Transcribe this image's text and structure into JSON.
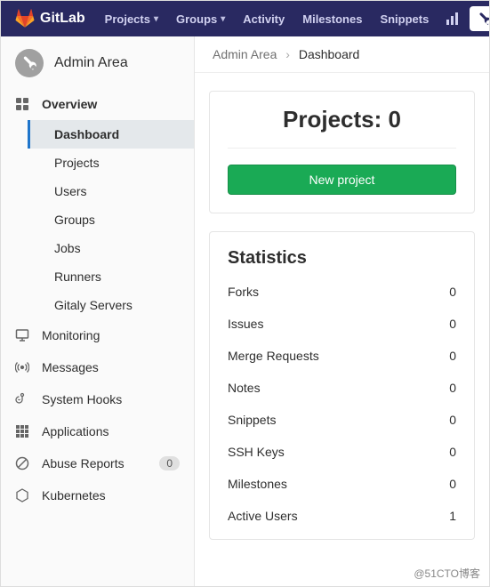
{
  "brand": "GitLab",
  "topnav": {
    "items": [
      {
        "label": "Projects",
        "has_dropdown": true
      },
      {
        "label": "Groups",
        "has_dropdown": true
      },
      {
        "label": "Activity",
        "has_dropdown": false
      },
      {
        "label": "Milestones",
        "has_dropdown": false
      },
      {
        "label": "Snippets",
        "has_dropdown": false
      }
    ]
  },
  "sidebar": {
    "title": "Admin Area",
    "overview_label": "Overview",
    "overview_children": [
      {
        "label": "Dashboard"
      },
      {
        "label": "Projects"
      },
      {
        "label": "Users"
      },
      {
        "label": "Groups"
      },
      {
        "label": "Jobs"
      },
      {
        "label": "Runners"
      },
      {
        "label": "Gitaly Servers"
      }
    ],
    "items": [
      {
        "label": "Monitoring"
      },
      {
        "label": "Messages"
      },
      {
        "label": "System Hooks"
      },
      {
        "label": "Applications"
      },
      {
        "label": "Abuse Reports",
        "badge": "0"
      },
      {
        "label": "Kubernetes"
      }
    ]
  },
  "breadcrumb": {
    "root": "Admin Area",
    "current": "Dashboard"
  },
  "projects_card": {
    "title": "Projects: 0",
    "button": "New project"
  },
  "statistics": {
    "title": "Statistics",
    "rows": [
      {
        "label": "Forks",
        "value": "0"
      },
      {
        "label": "Issues",
        "value": "0"
      },
      {
        "label": "Merge Requests",
        "value": "0"
      },
      {
        "label": "Notes",
        "value": "0"
      },
      {
        "label": "Snippets",
        "value": "0"
      },
      {
        "label": "SSH Keys",
        "value": "0"
      },
      {
        "label": "Milestones",
        "value": "0"
      },
      {
        "label": "Active Users",
        "value": "1"
      }
    ]
  },
  "watermark": "@51CTO博客"
}
